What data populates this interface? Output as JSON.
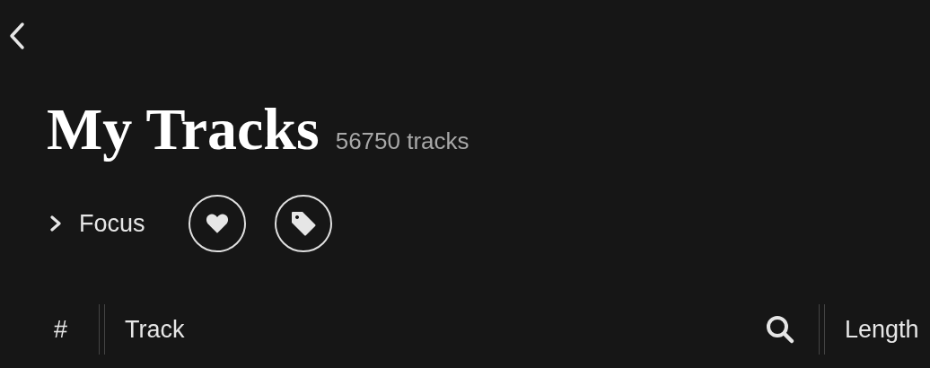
{
  "header": {
    "title": "My Tracks",
    "count": "56750 tracks"
  },
  "focus": {
    "label": "Focus",
    "expanded": false
  },
  "columns": [
    {
      "label": "#"
    },
    {
      "label": "Track"
    },
    {
      "label": "Length"
    }
  ]
}
